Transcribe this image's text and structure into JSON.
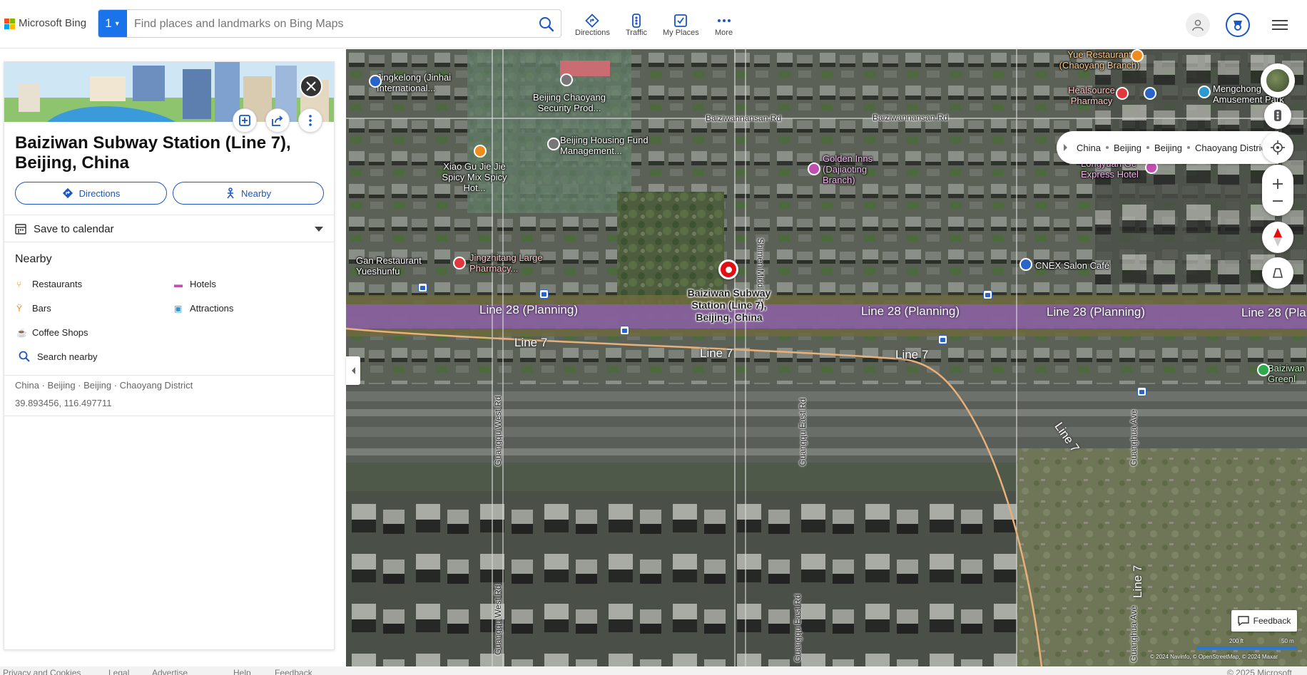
{
  "brand": {
    "name": "Microsoft Bing"
  },
  "search": {
    "badge": "1",
    "placeholder": "Find places and landmarks on Bing Maps",
    "value": ""
  },
  "nav": [
    {
      "label": "Directions",
      "icon": "directions-icon"
    },
    {
      "label": "Traffic",
      "icon": "traffic-icon"
    },
    {
      "label": "My Places",
      "icon": "my-places-icon"
    },
    {
      "label": "More",
      "icon": "more-icon"
    }
  ],
  "panel": {
    "title": "Baiziwan Subway Station (Line 7), Beijing, China",
    "directions_label": "Directions",
    "nearby_label": "Nearby",
    "calendar_label": "Save to calendar",
    "nearby_heading": "Nearby",
    "nearby_items": [
      "Restaurants",
      "Hotels",
      "Bars",
      "Attractions",
      "Coffee Shops"
    ],
    "search_nearby": "Search nearby",
    "address": "China · Beijing · Beijing · Chaoyang District",
    "coordinates": "39.893456, 116.497711"
  },
  "map": {
    "breadcrumb": [
      "China",
      "Beijing",
      "Beijing",
      "Chaoyang District"
    ],
    "pin_label": "Baiziwan Subway Station (Line 7), Beijing, China",
    "poi_labels": {
      "jingkelong": "Jingkelong (Jinhai International...",
      "security": "Beijing Chaoyang Security Prod...",
      "housing": "Beijing Housing Fund Management...",
      "xiaogu": "Xiao Gu Jie Jie Spicy Mix Spicy Hot...",
      "golden_inns": "Golden Inns (Dajiaoting Branch)",
      "gan": "Gan Restaurant Yueshunfu",
      "jingzhitang": "Jingzhitang Large Pharmacy...",
      "cnex": "CNEX Salon Café",
      "yue": "Yue Restaurant (Chaoyang Branch)",
      "healsource": "Healsource Pharmacy",
      "mengchong": "Mengchong Amusement Park",
      "longyuan": "Longyuan Ge Express Hotel",
      "baiziwan_green": "Baiziwan Greenl"
    },
    "road_labels": {
      "nansan1": "Baiziwannansan Rd",
      "nansan2": "Baiziwannansan Rd",
      "shimen": "Shimen Middle Rd",
      "guanghua": "Guanghua Ave",
      "guanghua2": "Guanghua Ave",
      "guangqu_w": "Guangqu West Rd",
      "guangqu_w2": "Guangqu West Rd",
      "guangqu_e": "Guangqu East Rd",
      "guangqu_e2": "Guangqu East Rd"
    },
    "lines": {
      "planning": "Line 28 (Planning)",
      "planning_cut": "Line 28 (Pla",
      "line7": "Line 7"
    },
    "feedback": "Feedback",
    "scale_left": "200 ft",
    "scale_right": "50 m",
    "copyright": "© 2024 Navinfo, © OpenStreetMap, © 2024 Maxar"
  },
  "footer": {
    "links": [
      "Privacy and Cookies",
      "Legal",
      "Advertise",
      "Help",
      "Feedback"
    ],
    "copyright": "© 2025 Microsoft"
  },
  "colors": {
    "accent": "#1a56c6",
    "badge": "#1a73e8",
    "pin": "#e30e12",
    "line_plan": "#8a5fa8",
    "line7": "#e8b07a"
  }
}
